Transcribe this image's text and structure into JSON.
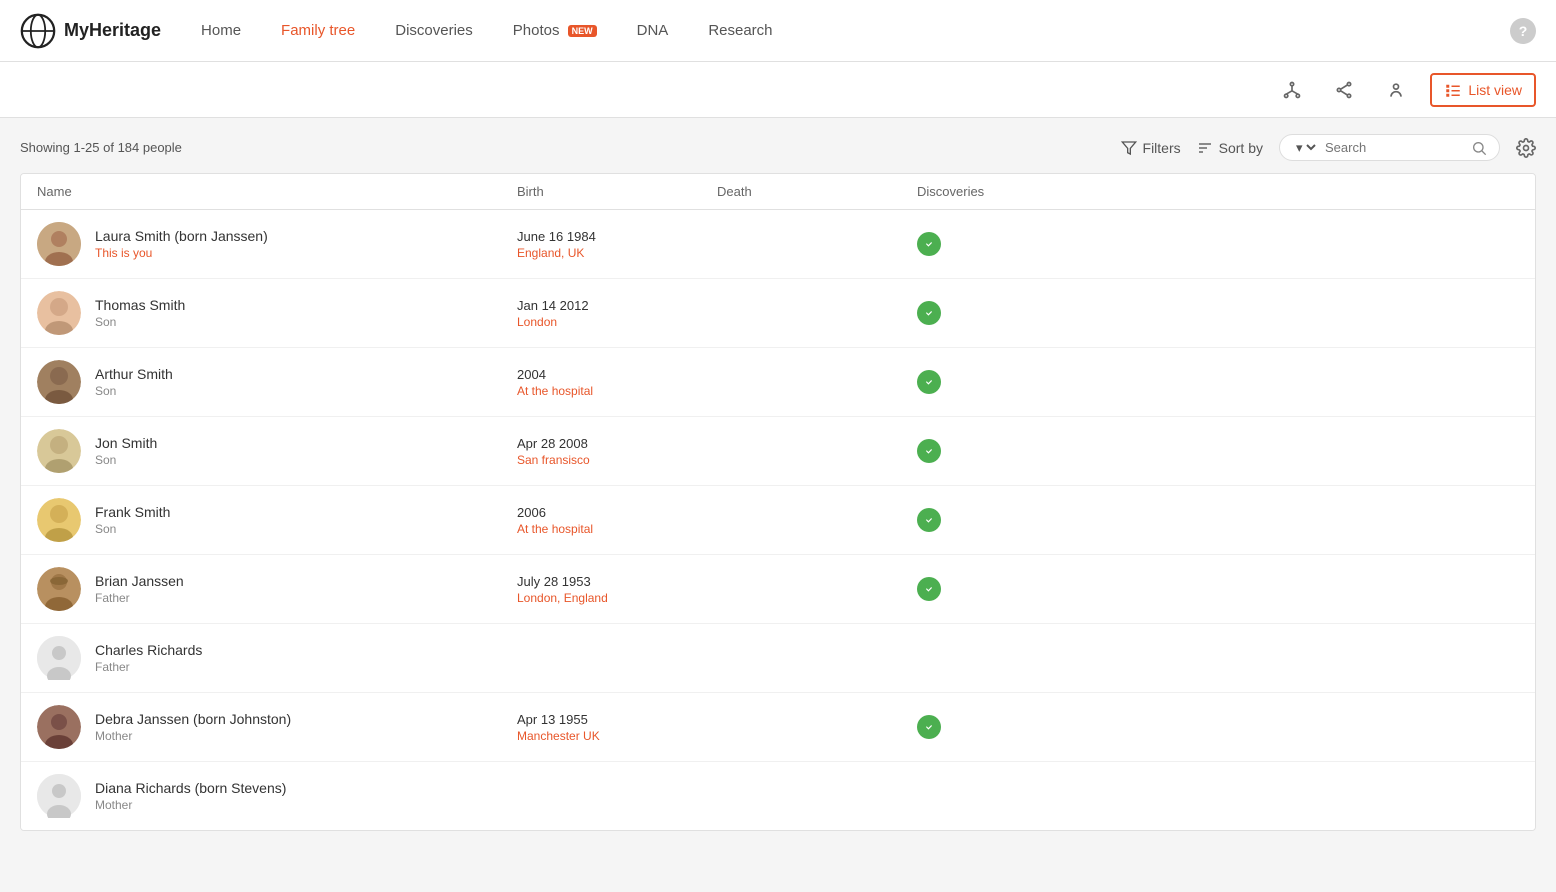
{
  "logo": {
    "text": "MyHeritage"
  },
  "nav": {
    "links": [
      {
        "label": "Home",
        "active": false
      },
      {
        "label": "Family tree",
        "active": true
      },
      {
        "label": "Discoveries",
        "active": false
      },
      {
        "label": "Photos",
        "active": false,
        "badge": "NEW"
      },
      {
        "label": "DNA",
        "active": false
      },
      {
        "label": "Research",
        "active": false
      }
    ]
  },
  "second_bar": {
    "view_icons": [
      {
        "name": "tree-icon",
        "label": ""
      },
      {
        "name": "share-icon",
        "label": ""
      },
      {
        "name": "person-icon",
        "label": ""
      }
    ],
    "list_view_label": "List view"
  },
  "toolbar": {
    "showing": "Showing 1-25 of 184 people",
    "filters_label": "Filters",
    "sort_by_label": "Sort by",
    "search_placeholder": "Search",
    "search_dropdown_label": ""
  },
  "table": {
    "columns": [
      "Name",
      "Birth",
      "Death",
      "Discoveries"
    ],
    "rows": [
      {
        "name": "Laura Smith (born Janssen)",
        "relation": "This is you",
        "relation_type": "you",
        "birth_date": "June 16 1984",
        "birth_place": "England, UK",
        "death_date": "",
        "death_place": "",
        "has_discovery": true,
        "avatar_type": "laura"
      },
      {
        "name": "Thomas Smith",
        "relation": "Son",
        "relation_type": "relation",
        "birth_date": "Jan 14 2012",
        "birth_place": "London",
        "death_date": "",
        "death_place": "",
        "has_discovery": true,
        "avatar_type": "thomas"
      },
      {
        "name": "Arthur Smith",
        "relation": "Son",
        "relation_type": "relation",
        "birth_date": "2004",
        "birth_place": "At the hospital",
        "death_date": "",
        "death_place": "",
        "has_discovery": true,
        "avatar_type": "arthur"
      },
      {
        "name": "Jon Smith",
        "relation": "Son",
        "relation_type": "relation",
        "birth_date": "Apr 28 2008",
        "birth_place": "San fransisco",
        "death_date": "",
        "death_place": "",
        "has_discovery": true,
        "avatar_type": "jon"
      },
      {
        "name": "Frank Smith",
        "relation": "Son",
        "relation_type": "relation",
        "birth_date": "2006",
        "birth_place": "At the hospital",
        "death_date": "",
        "death_place": "",
        "has_discovery": true,
        "avatar_type": "frank"
      },
      {
        "name": "Brian Janssen",
        "relation": "Father",
        "relation_type": "relation",
        "birth_date": "July 28 1953",
        "birth_place": "London, England",
        "death_date": "",
        "death_place": "",
        "has_discovery": true,
        "avatar_type": "brian"
      },
      {
        "name": "Charles Richards",
        "relation": "Father",
        "relation_type": "relation",
        "birth_date": "",
        "birth_place": "",
        "death_date": "",
        "death_place": "",
        "has_discovery": false,
        "avatar_type": "placeholder"
      },
      {
        "name": "Debra Janssen (born Johnston)",
        "relation": "Mother",
        "relation_type": "relation",
        "birth_date": "Apr 13 1955",
        "birth_place": "Manchester UK",
        "death_date": "",
        "death_place": "",
        "has_discovery": true,
        "avatar_type": "debra"
      },
      {
        "name": "Diana Richards (born Stevens)",
        "relation": "Mother",
        "relation_type": "relation",
        "birth_date": "",
        "birth_place": "",
        "death_date": "",
        "death_place": "",
        "has_discovery": false,
        "avatar_type": "placeholder"
      }
    ]
  }
}
